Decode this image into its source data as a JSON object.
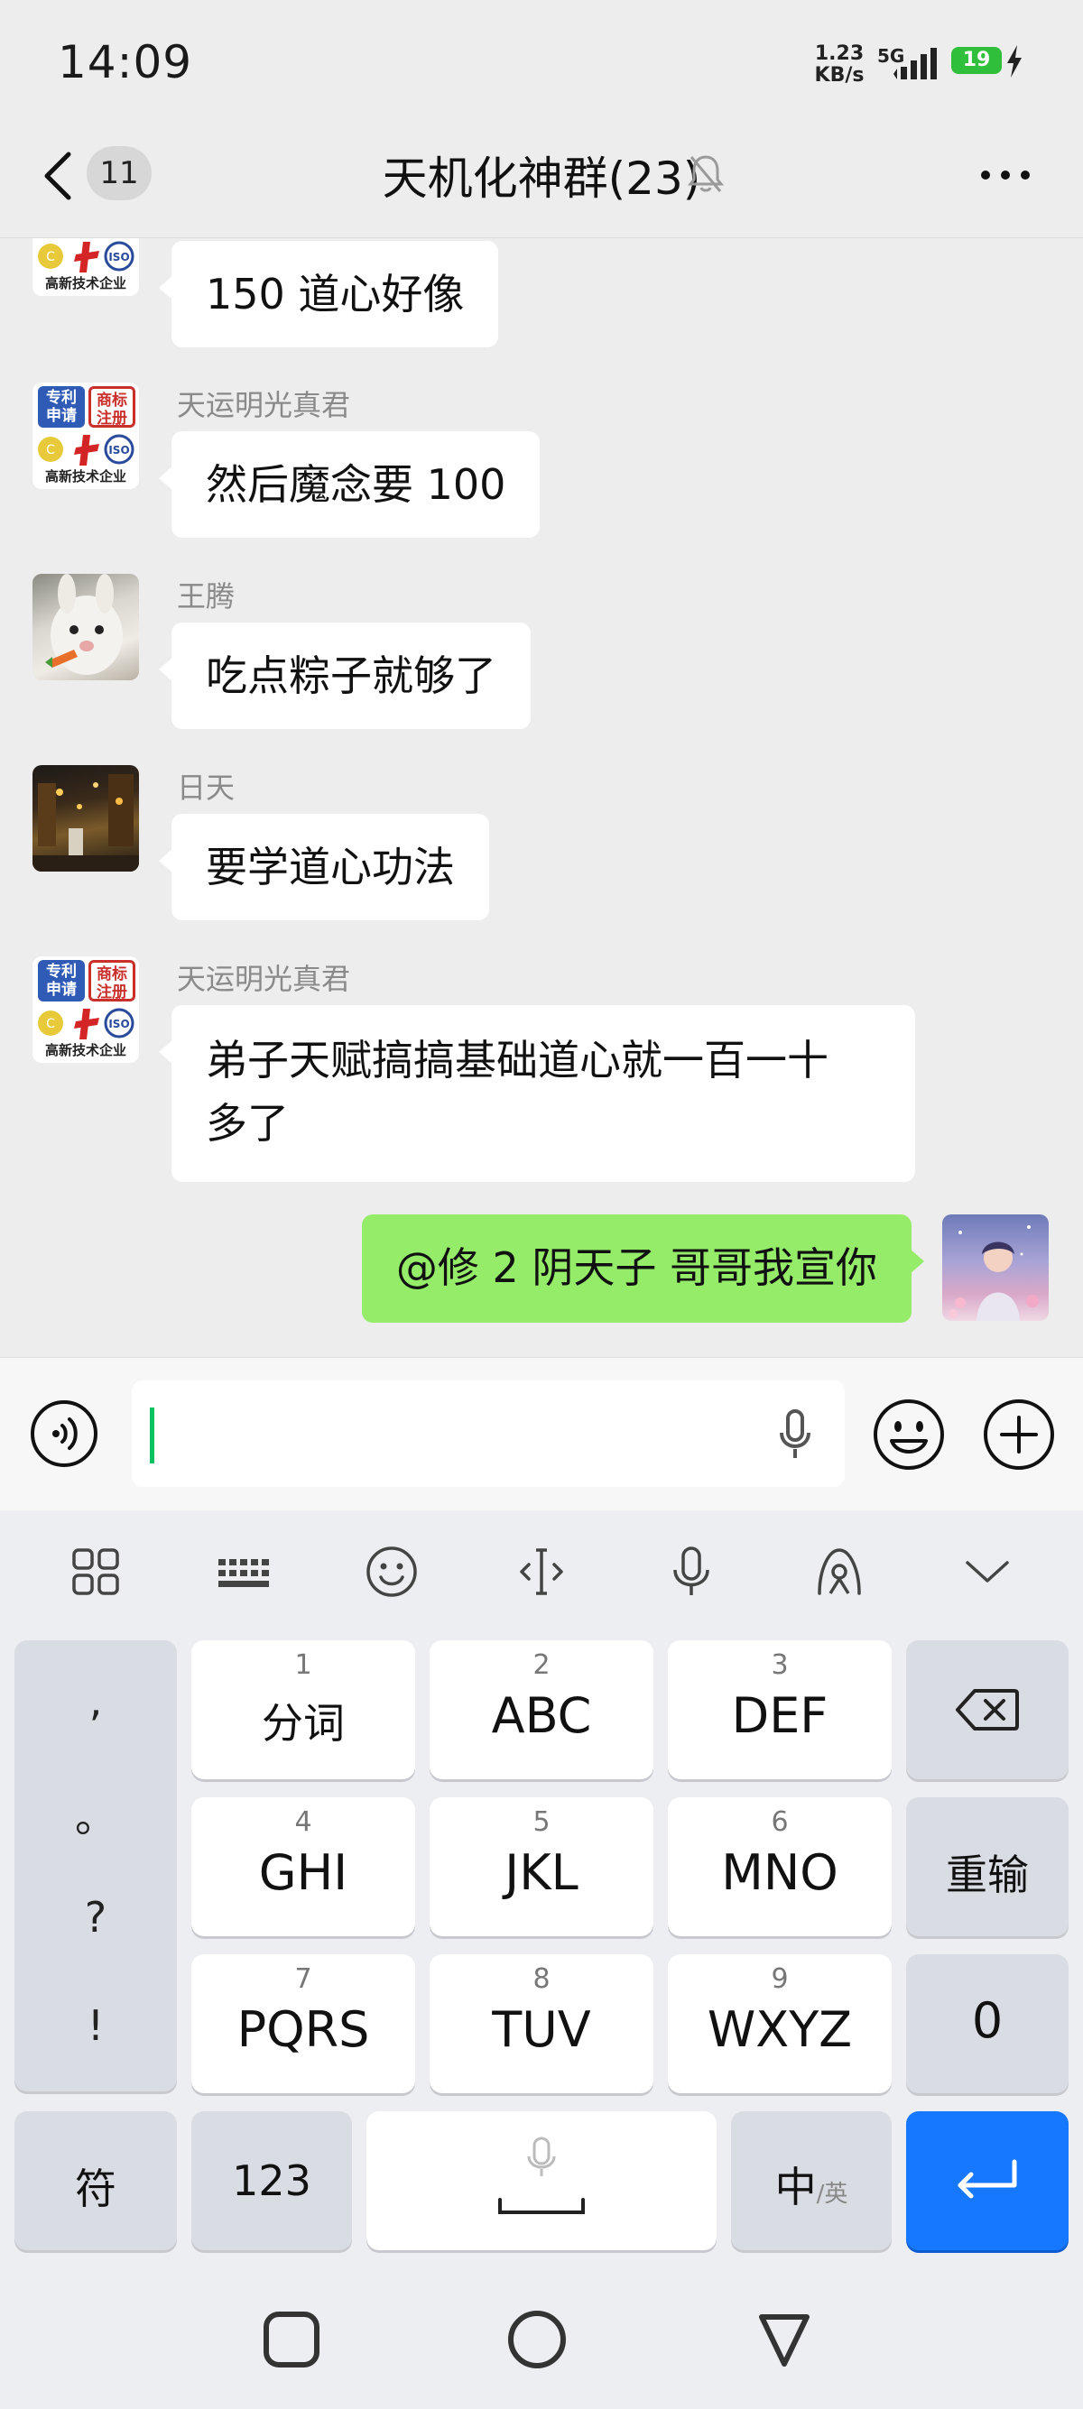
{
  "status_bar": {
    "time": "14:09",
    "net_speed_value": "1.23",
    "net_speed_unit": "KB/s",
    "network": "5G",
    "battery": "19"
  },
  "header": {
    "unread_count": "11",
    "title": "天机化神群(23)",
    "icons": [
      "back-chevron-icon",
      "mute-bell-icon",
      "more-dots-icon"
    ]
  },
  "messages": [
    {
      "sender": "",
      "text": "150 道心好像",
      "avatar": "corp-logo"
    },
    {
      "sender": "天运明光真君",
      "text": "然后魔念要 100",
      "avatar": "corp-logo"
    },
    {
      "sender": "王腾",
      "text": "吃点粽子就够了",
      "avatar": "rabbit-photo"
    },
    {
      "sender": "日天",
      "text": "要学道心功法",
      "avatar": "night-street-photo"
    },
    {
      "sender": "天运明光真君",
      "text_line1": "弟子天赋搞搞基础道心就一百一十",
      "text_line2": "多了",
      "avatar": "corp-logo"
    },
    {
      "sender": "me",
      "text": "@修 2 阴天子  哥哥我宣你",
      "avatar": "anime-boy"
    }
  ],
  "corp_avatar": {
    "tile1": "专利\n申请",
    "tile2": "商标\n注册",
    "caption": "高新技术企业",
    "iso": "ISO"
  },
  "input": {
    "value": ""
  },
  "keyboard": {
    "toolbar": [
      "grid-icon",
      "keyboard-icon",
      "emoji-icon",
      "cursor-icon",
      "mic-icon",
      "handwrite-icon",
      "collapse-icon"
    ],
    "punct": [
      ",",
      "。",
      "?",
      "!"
    ],
    "keys": [
      {
        "num": "1",
        "label": "分词"
      },
      {
        "num": "2",
        "label": "ABC"
      },
      {
        "num": "3",
        "label": "DEF"
      },
      {
        "num": "4",
        "label": "GHI"
      },
      {
        "num": "5",
        "label": "JKL"
      },
      {
        "num": "6",
        "label": "MNO"
      },
      {
        "num": "7",
        "label": "PQRS"
      },
      {
        "num": "8",
        "label": "TUV"
      },
      {
        "num": "9",
        "label": "WXYZ"
      }
    ],
    "reenter": "重输",
    "zero": "0",
    "symbols": "符",
    "numbers": "123",
    "lang_main": "中",
    "lang_alt": "/英"
  }
}
